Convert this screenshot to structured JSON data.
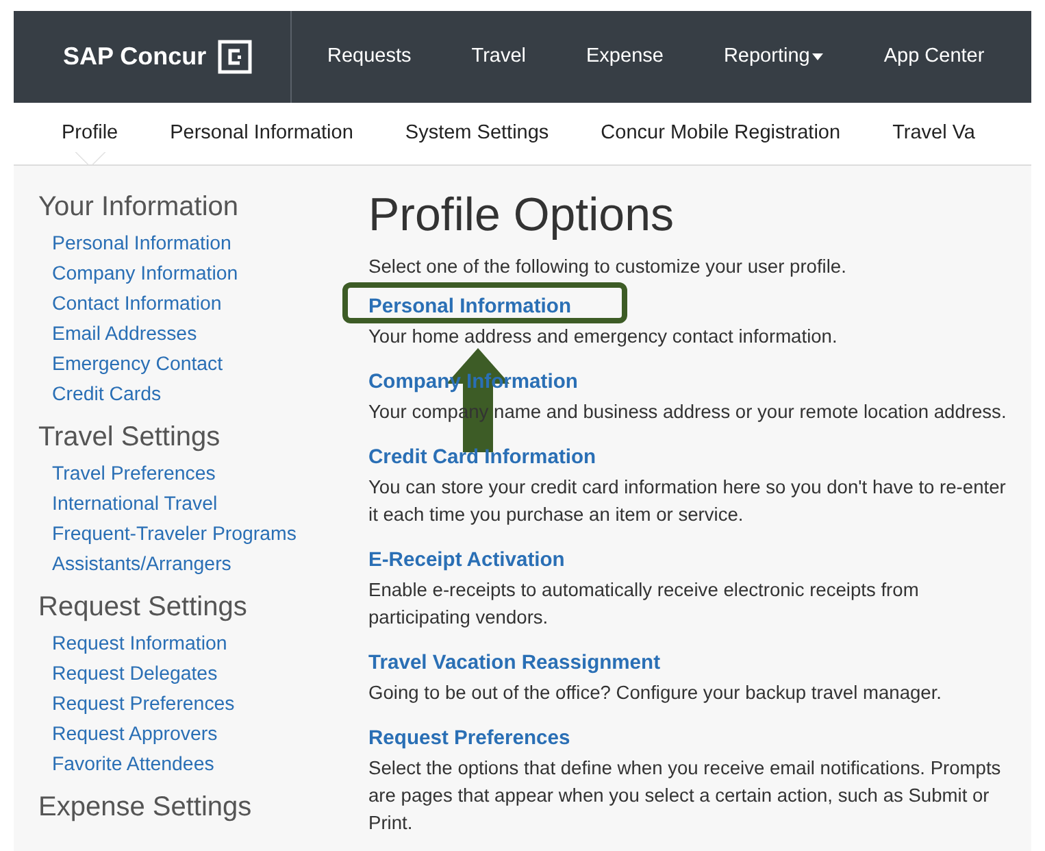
{
  "navbar": {
    "brand": "SAP Concur",
    "items": [
      {
        "label": "Requests",
        "dropdown": false
      },
      {
        "label": "Travel",
        "dropdown": false
      },
      {
        "label": "Expense",
        "dropdown": false
      },
      {
        "label": "Reporting",
        "dropdown": true
      },
      {
        "label": "App Center",
        "dropdown": false
      }
    ]
  },
  "subnav": [
    {
      "label": "Profile",
      "selected": true
    },
    {
      "label": "Personal Information",
      "selected": false
    },
    {
      "label": "System Settings",
      "selected": false
    },
    {
      "label": "Concur Mobile Registration",
      "selected": false
    },
    {
      "label": "Travel Va",
      "selected": false
    }
  ],
  "sidebar": [
    {
      "heading": "Your Information",
      "links": [
        "Personal Information",
        "Company Information",
        "Contact Information",
        "Email Addresses",
        "Emergency Contact",
        "Credit Cards"
      ]
    },
    {
      "heading": "Travel Settings",
      "links": [
        "Travel Preferences",
        "International Travel",
        "Frequent-Traveler Programs",
        "Assistants/Arrangers"
      ]
    },
    {
      "heading": "Request Settings",
      "links": [
        "Request Information",
        "Request Delegates",
        "Request Preferences",
        "Request Approvers",
        "Favorite Attendees"
      ]
    },
    {
      "heading": "Expense Settings"
    }
  ],
  "main": {
    "title": "Profile Options",
    "intro": "Select one of the following to customize your user profile.",
    "options": [
      {
        "title": "Personal Information",
        "description": "Your home address and emergency contact information.",
        "highlighted": true
      },
      {
        "title": "Company Information",
        "description": "Your company name and business address or your remote location address.",
        "highlighted": false
      },
      {
        "title": "Credit Card Information",
        "description": "You can store your credit card information here so you don't have to re-enter it each time you purchase an item or service.",
        "highlighted": false
      },
      {
        "title": "E-Receipt Activation",
        "description": "Enable e-receipts to automatically receive electronic receipts from participating vendors.",
        "highlighted": false
      },
      {
        "title": "Travel Vacation Reassignment",
        "description": "Going to be out of the office? Configure your backup travel manager.",
        "highlighted": false
      },
      {
        "title": "Request Preferences",
        "description": "Select the options that define when you receive email notifications. Prompts are pages that appear when you select a certain action, such as Submit or Print.",
        "highlighted": false
      }
    ]
  }
}
